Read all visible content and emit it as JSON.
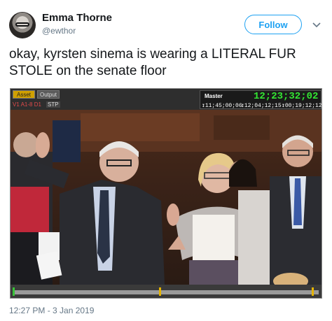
{
  "tweet": {
    "author_name": "Emma Thorne",
    "author_handle": "@ewthor",
    "follow_label": "Follow",
    "text": "okay, kyrsten sinema is wearing a LITERAL FUR STOLE on the senate floor",
    "timestamp": "12:27 PM - 3 Jan 2019"
  },
  "video_overlay": {
    "tab_asset": "Asset",
    "tab_output": "Output",
    "clip_label": "V1 A1-8 D1",
    "stp_label": "STP",
    "master_label": "Master",
    "timecode_main": "12;23;32;02",
    "timecode_in": "↧11;45;00;06",
    "timecode_out": "↧12;04;12;15",
    "timecode_duration": "↧00;19;12;12"
  },
  "icons": {
    "chevron": "chevron-down-icon",
    "avatar": "avatar"
  },
  "colors": {
    "accent": "#1da1f2",
    "timecode": "#33e633",
    "asset_tab": "#d0a000"
  }
}
